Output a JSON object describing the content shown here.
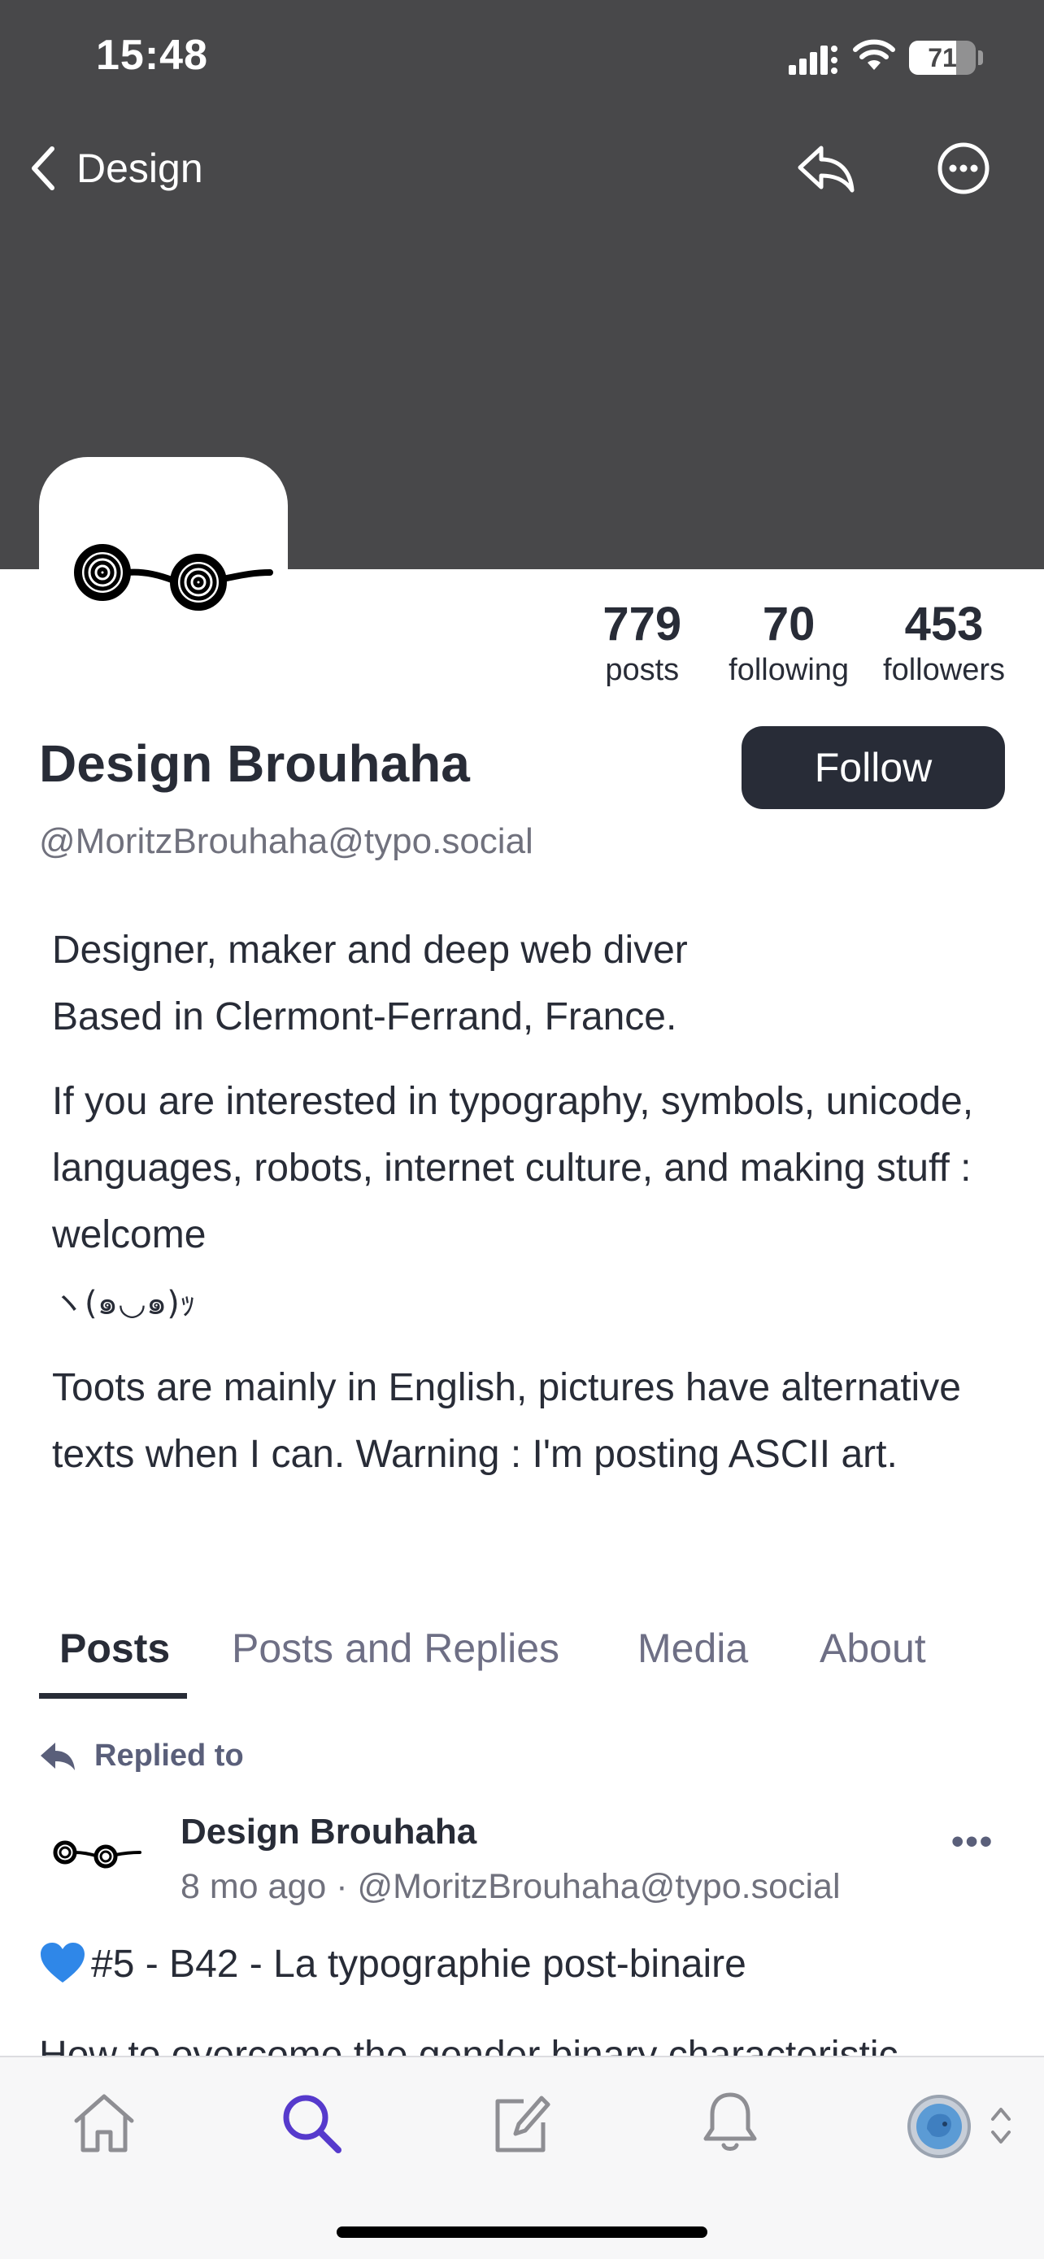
{
  "status_bar": {
    "time": "15:48",
    "battery": "71",
    "battery_level": 0.71
  },
  "nav": {
    "back_label": "Design"
  },
  "stats": [
    {
      "count": "779",
      "label": "posts"
    },
    {
      "count": "70",
      "label": "following"
    },
    {
      "count": "453",
      "label": "followers"
    }
  ],
  "profile": {
    "display_name": "Design Brouhaha",
    "follow_label": "Follow",
    "handle": "@MoritzBrouhaha@typo.social"
  },
  "bio": {
    "p1_line1": "Designer, maker and deep web diver",
    "p1_line2": "Based in Clermont-Ferrand, France.",
    "p2": "If you are interested in typography, symbols, unicode, languages, robots, internet culture, and making stuff : welcome",
    "p2_kaomoji": "ヽ(๑◡๑)ｯ",
    "p3": "Toots are mainly in English, pictures have alternative texts when I can. Warning : I'm posting ASCII art."
  },
  "tabs": [
    {
      "label": "Posts",
      "active": true
    },
    {
      "label": "Posts and Replies",
      "active": false
    },
    {
      "label": "Media",
      "active": false
    },
    {
      "label": "About",
      "active": false
    }
  ],
  "post": {
    "context": "Replied to",
    "author": "Design Brouhaha",
    "meta": "8 mo ago · @MoritzBrouhaha@typo.social",
    "more": "•••",
    "title": "#5 - B42 - La typographie post-binaire",
    "body": "How to overcome the gender binary characteristic"
  },
  "tabbar": {
    "items": [
      "home-icon",
      "search-icon",
      "compose-icon",
      "bell-icon",
      "account-avatar-icon"
    ],
    "active": "search-icon"
  },
  "colors": {
    "banner": "#48484a",
    "text": "#282c37",
    "muted": "#70717d",
    "accent": "#563acc",
    "tabbar_bg": "#f7f7f8"
  }
}
